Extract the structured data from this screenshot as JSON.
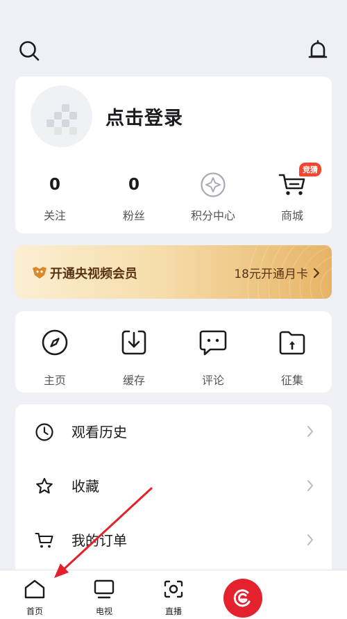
{
  "profile": {
    "login_label": "点击登录",
    "stats": [
      {
        "value": "0",
        "label": "关注"
      },
      {
        "value": "0",
        "label": "粉丝"
      },
      {
        "label": "积分中心",
        "icon": "diamond-star-icon"
      },
      {
        "label": "商城",
        "icon": "cart-icon",
        "badge": "竞猜"
      }
    ]
  },
  "vip": {
    "title": "开通央视频会员",
    "cta": "18元开通月卡"
  },
  "quick": [
    {
      "label": "主页",
      "icon": "compass-icon"
    },
    {
      "label": "缓存",
      "icon": "download-icon"
    },
    {
      "label": "评论",
      "icon": "comment-icon"
    },
    {
      "label": "征集",
      "icon": "folder-upload-icon"
    }
  ],
  "menu": [
    {
      "label": "观看历史",
      "icon": "clock-icon"
    },
    {
      "label": "收藏",
      "icon": "star-icon"
    },
    {
      "label": "我的订单",
      "icon": "cart-icon"
    }
  ],
  "nav": [
    {
      "label": "首页",
      "icon": "home-icon"
    },
    {
      "label": "电视",
      "icon": "tv-icon"
    },
    {
      "label": "直播",
      "icon": "live-icon"
    },
    {
      "label": "",
      "icon": "center-logo-icon"
    }
  ],
  "colors": {
    "accent_red": "#e4222e",
    "vip_text": "#5a3412",
    "badge_red": "#f24630"
  }
}
